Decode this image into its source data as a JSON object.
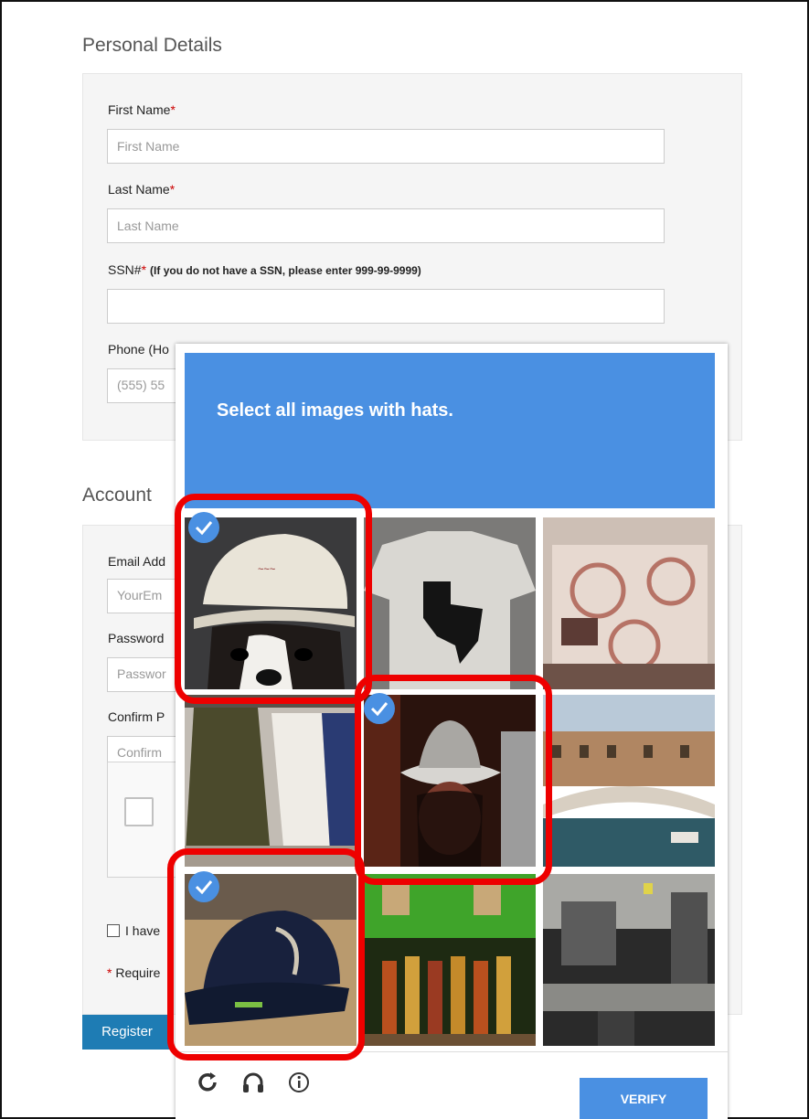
{
  "personal": {
    "title": "Personal Details",
    "first_name_label": "First Name",
    "first_name_placeholder": "First Name",
    "last_name_label": "Last Name",
    "last_name_placeholder": "Last Name",
    "ssn_label": "SSN#",
    "ssn_note": "(If you do not have a SSN, please enter 999-99-9999)",
    "phone_label": "Phone (Ho",
    "phone_placeholder": "(555) 55"
  },
  "account": {
    "title": "Account",
    "email_label": "Email Add",
    "email_placeholder": "YourEm",
    "password_label": "Password",
    "password_placeholder": "Passwor",
    "confirm_label": "Confirm P",
    "confirm_placeholder": "Confirm",
    "agree_text": "I have",
    "required_text": "Require",
    "required_mark": "*"
  },
  "register_label": "Register",
  "captcha": {
    "prompt": "Select all images with hats.",
    "verify_label": "VERIFY",
    "selected_tiles": [
      0,
      4,
      6
    ],
    "tiles": [
      "dog-with-cap",
      "texas-tshirt",
      "patterned-pillow",
      "clothing-rack",
      "person-with-cowboy-hat",
      "venice-canal-bridge",
      "baseball-cap",
      "bottles-shelf",
      "kitchen-room"
    ],
    "accent_color": "#4a90e2"
  },
  "highlight_color": "#e00000"
}
